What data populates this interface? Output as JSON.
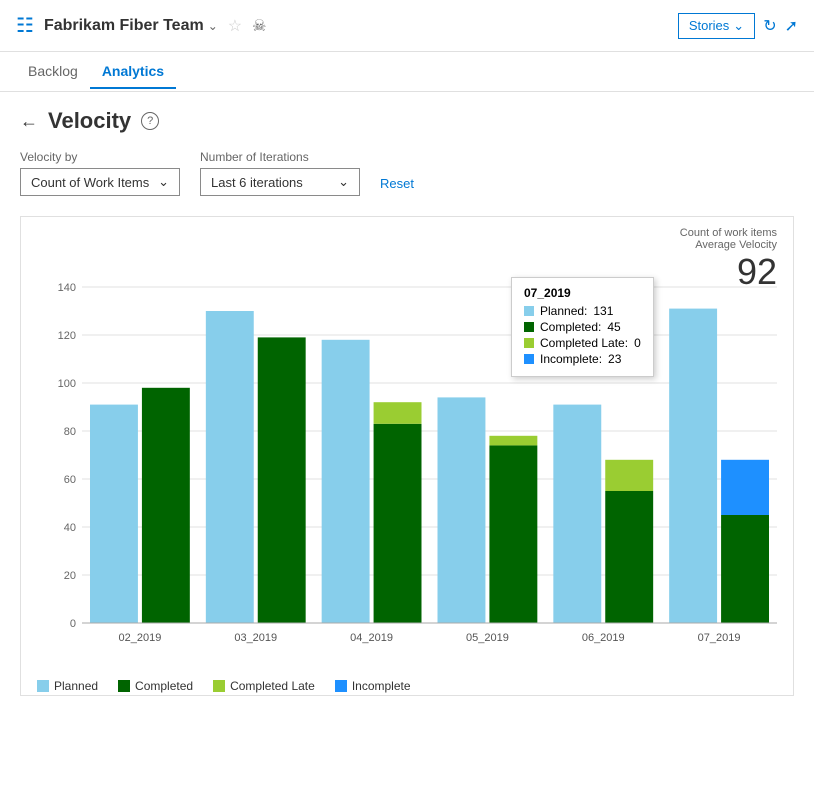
{
  "header": {
    "icon": "≡",
    "team_name": "Fabrikam Fiber Team",
    "chevron": "⌄",
    "star": "☆",
    "people": "⚇",
    "stories_label": "Stories",
    "stories_chevron": "⌄"
  },
  "nav": {
    "tabs": [
      {
        "id": "backlog",
        "label": "Backlog",
        "active": false
      },
      {
        "id": "analytics",
        "label": "Analytics",
        "active": true
      }
    ]
  },
  "page": {
    "title": "Velocity",
    "help_text": "?",
    "velocity_by_label": "Velocity by",
    "velocity_by_value": "Count of Work Items",
    "iterations_label": "Number of Iterations",
    "iterations_value": "Last 6 iterations",
    "reset_label": "Reset"
  },
  "chart": {
    "summary_label1": "Count of work items",
    "summary_label2": "Average Velocity",
    "summary_value": "92",
    "y_axis": [
      0,
      20,
      40,
      60,
      80,
      100,
      120,
      140
    ],
    "bars": [
      {
        "label": "02_2019",
        "planned": 91,
        "completed": 98,
        "completed_late": 0,
        "incomplete": 0
      },
      {
        "label": "03_2019",
        "planned": 130,
        "completed": 119,
        "completed_late": 0,
        "incomplete": 0
      },
      {
        "label": "04_2019",
        "planned": 118,
        "completed": 83,
        "completed_late": 9,
        "incomplete": 0
      },
      {
        "label": "05_2019",
        "planned": 94,
        "completed": 74,
        "completed_late": 4,
        "incomplete": 0
      },
      {
        "label": "06_2019",
        "planned": 91,
        "completed": 55,
        "completed_late": 13,
        "incomplete": 0
      },
      {
        "label": "07_2019",
        "planned": 131,
        "completed": 45,
        "completed_late": 0,
        "incomplete": 23
      }
    ],
    "tooltip": {
      "title": "07_2019",
      "planned": "131",
      "completed": "45",
      "completed_late": "0",
      "incomplete": "23"
    },
    "colors": {
      "planned": "#87CEEB",
      "completed": "#006400",
      "completed_late": "#9ACD32",
      "incomplete": "#1E90FF"
    }
  },
  "legend": [
    {
      "key": "planned",
      "label": "Planned",
      "color": "#87CEEB"
    },
    {
      "key": "completed",
      "label": "Completed",
      "color": "#006400"
    },
    {
      "key": "completed_late",
      "label": "Completed Late",
      "color": "#9ACD32"
    },
    {
      "key": "incomplete",
      "label": "Incomplete",
      "color": "#1E90FF"
    }
  ]
}
